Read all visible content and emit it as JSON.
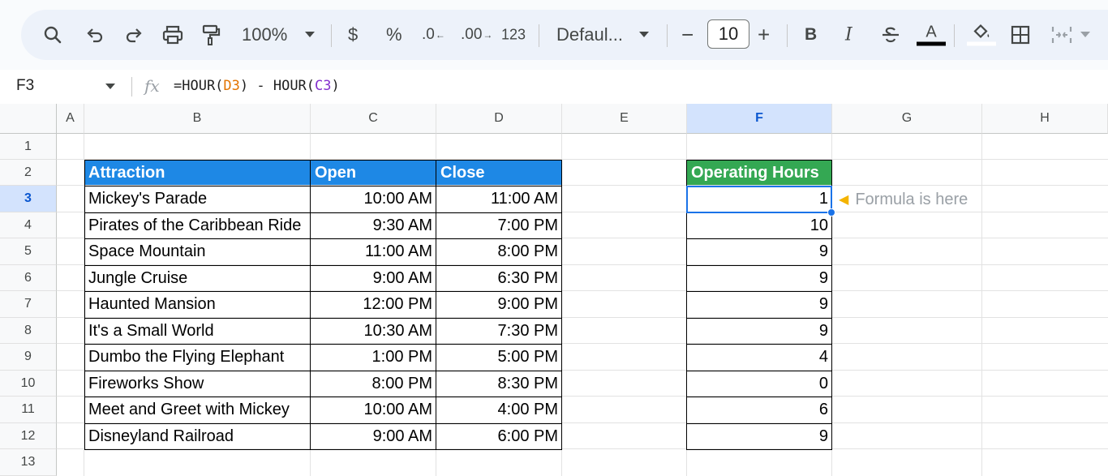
{
  "toolbar": {
    "zoom": "100%",
    "currency": "$",
    "percent": "%",
    "decrease_decimal": ".0",
    "increase_decimal": ".00",
    "number_format": "123",
    "font": "Defaul...",
    "font_size": "10",
    "minus": "−",
    "plus": "+",
    "bold": "B",
    "italic": "I",
    "text_color": "A"
  },
  "formula_bar": {
    "cell_ref": "F3",
    "fx": "fx",
    "formula_prefix": "=HOUR(",
    "ref1": "D3",
    "formula_mid": ") - HOUR(",
    "ref2": "C3",
    "formula_suffix": ")"
  },
  "columns": [
    "A",
    "B",
    "C",
    "D",
    "E",
    "F",
    "G",
    "H"
  ],
  "rows": [
    "1",
    "2",
    "3",
    "4",
    "5",
    "6",
    "7",
    "8",
    "9",
    "10",
    "11",
    "12",
    "13"
  ],
  "table": {
    "headers": {
      "attraction": "Attraction",
      "open": "Open",
      "close": "Close",
      "hours": "Operating Hours"
    },
    "rows": [
      {
        "attraction": "Mickey's Parade",
        "open": "10:00 AM",
        "close": "11:00 AM",
        "hours": "1"
      },
      {
        "attraction": "Pirates of the Caribbean Ride",
        "open": "9:30 AM",
        "close": "7:00 PM",
        "hours": "10"
      },
      {
        "attraction": "Space Mountain",
        "open": "11:00 AM",
        "close": "8:00 PM",
        "hours": "9"
      },
      {
        "attraction": "Jungle Cruise",
        "open": "9:00 AM",
        "close": "6:30 PM",
        "hours": "9"
      },
      {
        "attraction": "Haunted Mansion",
        "open": "12:00 PM",
        "close": "9:00 PM",
        "hours": "9"
      },
      {
        "attraction": "It's a Small World",
        "open": "10:30 AM",
        "close": "7:30 PM",
        "hours": "9"
      },
      {
        "attraction": "Dumbo the Flying Elephant",
        "open": "1:00 PM",
        "close": "5:00 PM",
        "hours": "4"
      },
      {
        "attraction": "Fireworks Show",
        "open": "8:00 PM",
        "close": "8:30 PM",
        "hours": "0"
      },
      {
        "attraction": "Meet and Greet with Mickey",
        "open": "10:00 AM",
        "close": "4:00 PM",
        "hours": "6"
      },
      {
        "attraction": "Disneyland Railroad",
        "open": "9:00 AM",
        "close": "6:00 PM",
        "hours": "9"
      }
    ]
  },
  "annotation": {
    "text": "Formula is here",
    "icon": "pointing-hand-icon"
  },
  "colors": {
    "header_blue": "#1e88e5",
    "header_green": "#34a853",
    "selection": "#1a73e8"
  }
}
